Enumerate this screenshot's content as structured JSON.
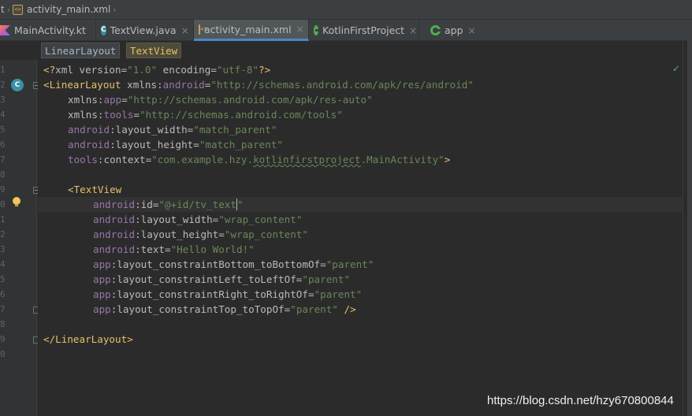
{
  "nav": {
    "root_fragment": "t",
    "file": "activity_main.xml",
    "sep": "›"
  },
  "tabs": [
    {
      "label": "MainActivity.kt",
      "icon": "kotlin-file-icon",
      "active": false,
      "close": ""
    },
    {
      "label": "TextView.java",
      "icon": "class-icon",
      "active": false,
      "close": "×"
    },
    {
      "label": "activity_main.xml",
      "icon": "xml-file-icon",
      "active": true,
      "close": "×"
    },
    {
      "label": "KotlinFirstProject",
      "icon": "gradle-icon",
      "active": false,
      "close": "×"
    },
    {
      "label": "app",
      "icon": "gradle-icon",
      "active": false,
      "close": "×"
    }
  ],
  "element_path": [
    "LinearLayout",
    "TextView"
  ],
  "gutter": {
    "class_badge": "C",
    "line_numbers": [
      "1",
      "2",
      "3",
      "4",
      "5",
      "6",
      "7",
      "8",
      "9",
      "0",
      "1",
      "2",
      "3",
      "4",
      "5",
      "6",
      "7",
      "8",
      "9",
      "0"
    ]
  },
  "code": {
    "l1": {
      "a": "<?",
      "b": "xml version",
      "c": "=",
      "d": "\"1.0\"",
      "e": " encoding",
      "f": "=",
      "g": "\"utf-8\"",
      "h": "?>"
    },
    "l2": {
      "a": "<LinearLayout",
      "b": " xmlns:",
      "c": "android",
      "d": "=",
      "e": "\"http://schemas.android.com/apk/res/android\""
    },
    "l3": {
      "a": "xmlns:",
      "b": "app",
      "c": "=",
      "d": "\"http://schemas.android.com/apk/res-auto\""
    },
    "l4": {
      "a": "xmlns:",
      "b": "tools",
      "c": "=",
      "d": "\"http://schemas.android.com/tools\""
    },
    "l5": {
      "a": "android",
      "b": ":layout_width",
      "c": "=",
      "d": "\"match_parent\""
    },
    "l6": {
      "a": "android",
      "b": ":layout_height",
      "c": "=",
      "d": "\"match_parent\""
    },
    "l7": {
      "a": "tools",
      "b": ":context",
      "c": "=",
      "d": "\"com.example.hzy.",
      "e": "kotlinfirstproject",
      "f": ".MainActivity\"",
      "g": ">"
    },
    "l9": {
      "a": "<TextView"
    },
    "l10": {
      "a": "android",
      "b": ":id",
      "c": "=",
      "d": "\"@+id/tv_text",
      "e": "\""
    },
    "l11": {
      "a": "android",
      "b": ":layout_width",
      "c": "=",
      "d": "\"wrap_content\""
    },
    "l12": {
      "a": "android",
      "b": ":layout_height",
      "c": "=",
      "d": "\"wrap_content\""
    },
    "l13": {
      "a": "android",
      "b": ":text",
      "c": "=",
      "d": "\"Hello World!\""
    },
    "l14": {
      "a": "app",
      "b": ":layout_constraintBottom_toBottomOf",
      "c": "=",
      "d": "\"parent\""
    },
    "l15": {
      "a": "app",
      "b": ":layout_constraintLeft_toLeftOf",
      "c": "=",
      "d": "\"parent\""
    },
    "l16": {
      "a": "app",
      "b": ":layout_constraintRight_toRightOf",
      "c": "=",
      "d": "\"parent\""
    },
    "l17": {
      "a": "app",
      "b": ":layout_constraintTop_toTopOf",
      "c": "=",
      "d": "\"parent\"",
      "e": " />"
    },
    "l19": {
      "a": "</LinearLayout>"
    }
  },
  "watermark": "https://blog.csdn.net/hzy670800844",
  "colors": {
    "tag": "#e8bf6a",
    "namespace": "#9876aa",
    "string": "#6a8759",
    "attribute": "#bababa",
    "background": "#2b2b2b",
    "active_tab_underline": "#4a88c7"
  }
}
